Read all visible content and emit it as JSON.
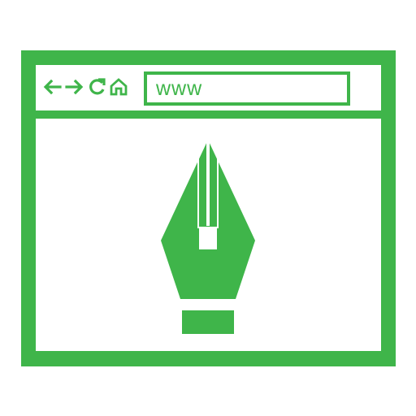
{
  "colors": {
    "accent": "#3fb54a",
    "background": "#ffffff"
  },
  "toolbar": {
    "back_icon": "arrow-left-icon",
    "forward_icon": "arrow-right-icon",
    "reload_icon": "reload-icon",
    "home_icon": "home-icon",
    "address_text": "www"
  },
  "content": {
    "illustration_icon": "pen-nib-icon"
  }
}
